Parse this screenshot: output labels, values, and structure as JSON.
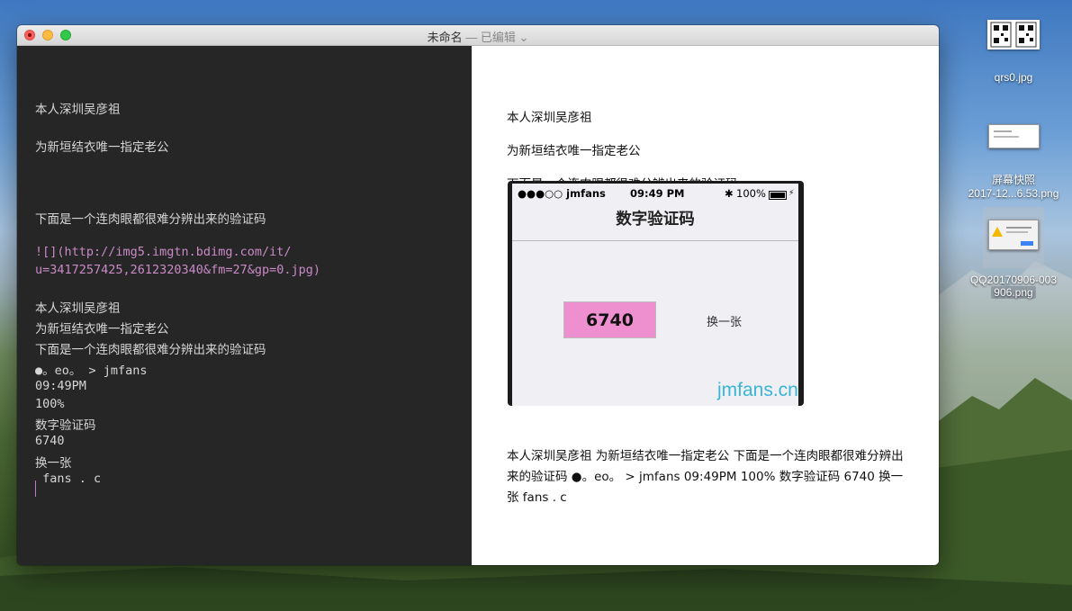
{
  "window": {
    "title": "未命名",
    "status": " — 已编辑 ⌄"
  },
  "editor": {
    "lines": [
      "本人深圳吴彦祖",
      "为新垣结衣唯一指定老公",
      "下面是一个连肉眼都很难分辨出来的验证码",
      "![](http://img5.imgtn.bdimg.com/it/",
      "u=3417257425,2612320340&fm=27&gp=0.jpg)",
      "本人深圳吴彦祖",
      "为新垣结衣唯一指定老公",
      "下面是一个连肉眼都很难分辨出来的验证码",
      "●。eo。 > jmfans",
      "09:49PM",
      "100%",
      "数字验证码",
      "6740",
      "换一张",
      " fans . c"
    ]
  },
  "preview": {
    "p1": "本人深圳吴彦祖",
    "p2": "为新垣结衣唯一指定老公",
    "p3": "下面是一个连肉眼都很难分辨出来的验证码",
    "ocr_text": "本人深圳吴彦祖 为新垣结衣唯一指定老公 下面是一个连肉眼都很难分辨出来的验证码 ●。eo。 > jmfans 09:49PM 100% 数字验证码 6740 换一张 fans . c",
    "image": {
      "carrier": "●●●○○ jmfans",
      "time": "09:49 PM",
      "bt": "✱",
      "battery": "100%",
      "charge": "⚡",
      "nav_title": "数字验证码",
      "code": "6740",
      "refresh": "换一张",
      "watermark": "jmfans.cn"
    }
  },
  "desktop": {
    "icons": [
      {
        "label1": "qrs0.jpg",
        "label2": ""
      },
      {
        "label1": "屏幕快照",
        "label2": "2017-12...6.53.png"
      },
      {
        "label1": "QQ20170906-003",
        "label2": "906.png"
      }
    ]
  },
  "colors": {
    "editor_bg": "#262626",
    "editor_text": "#d6d6d6",
    "link_text": "#c98ac6",
    "code_box": "#ee90cf",
    "watermark": "#3ab5d8"
  }
}
